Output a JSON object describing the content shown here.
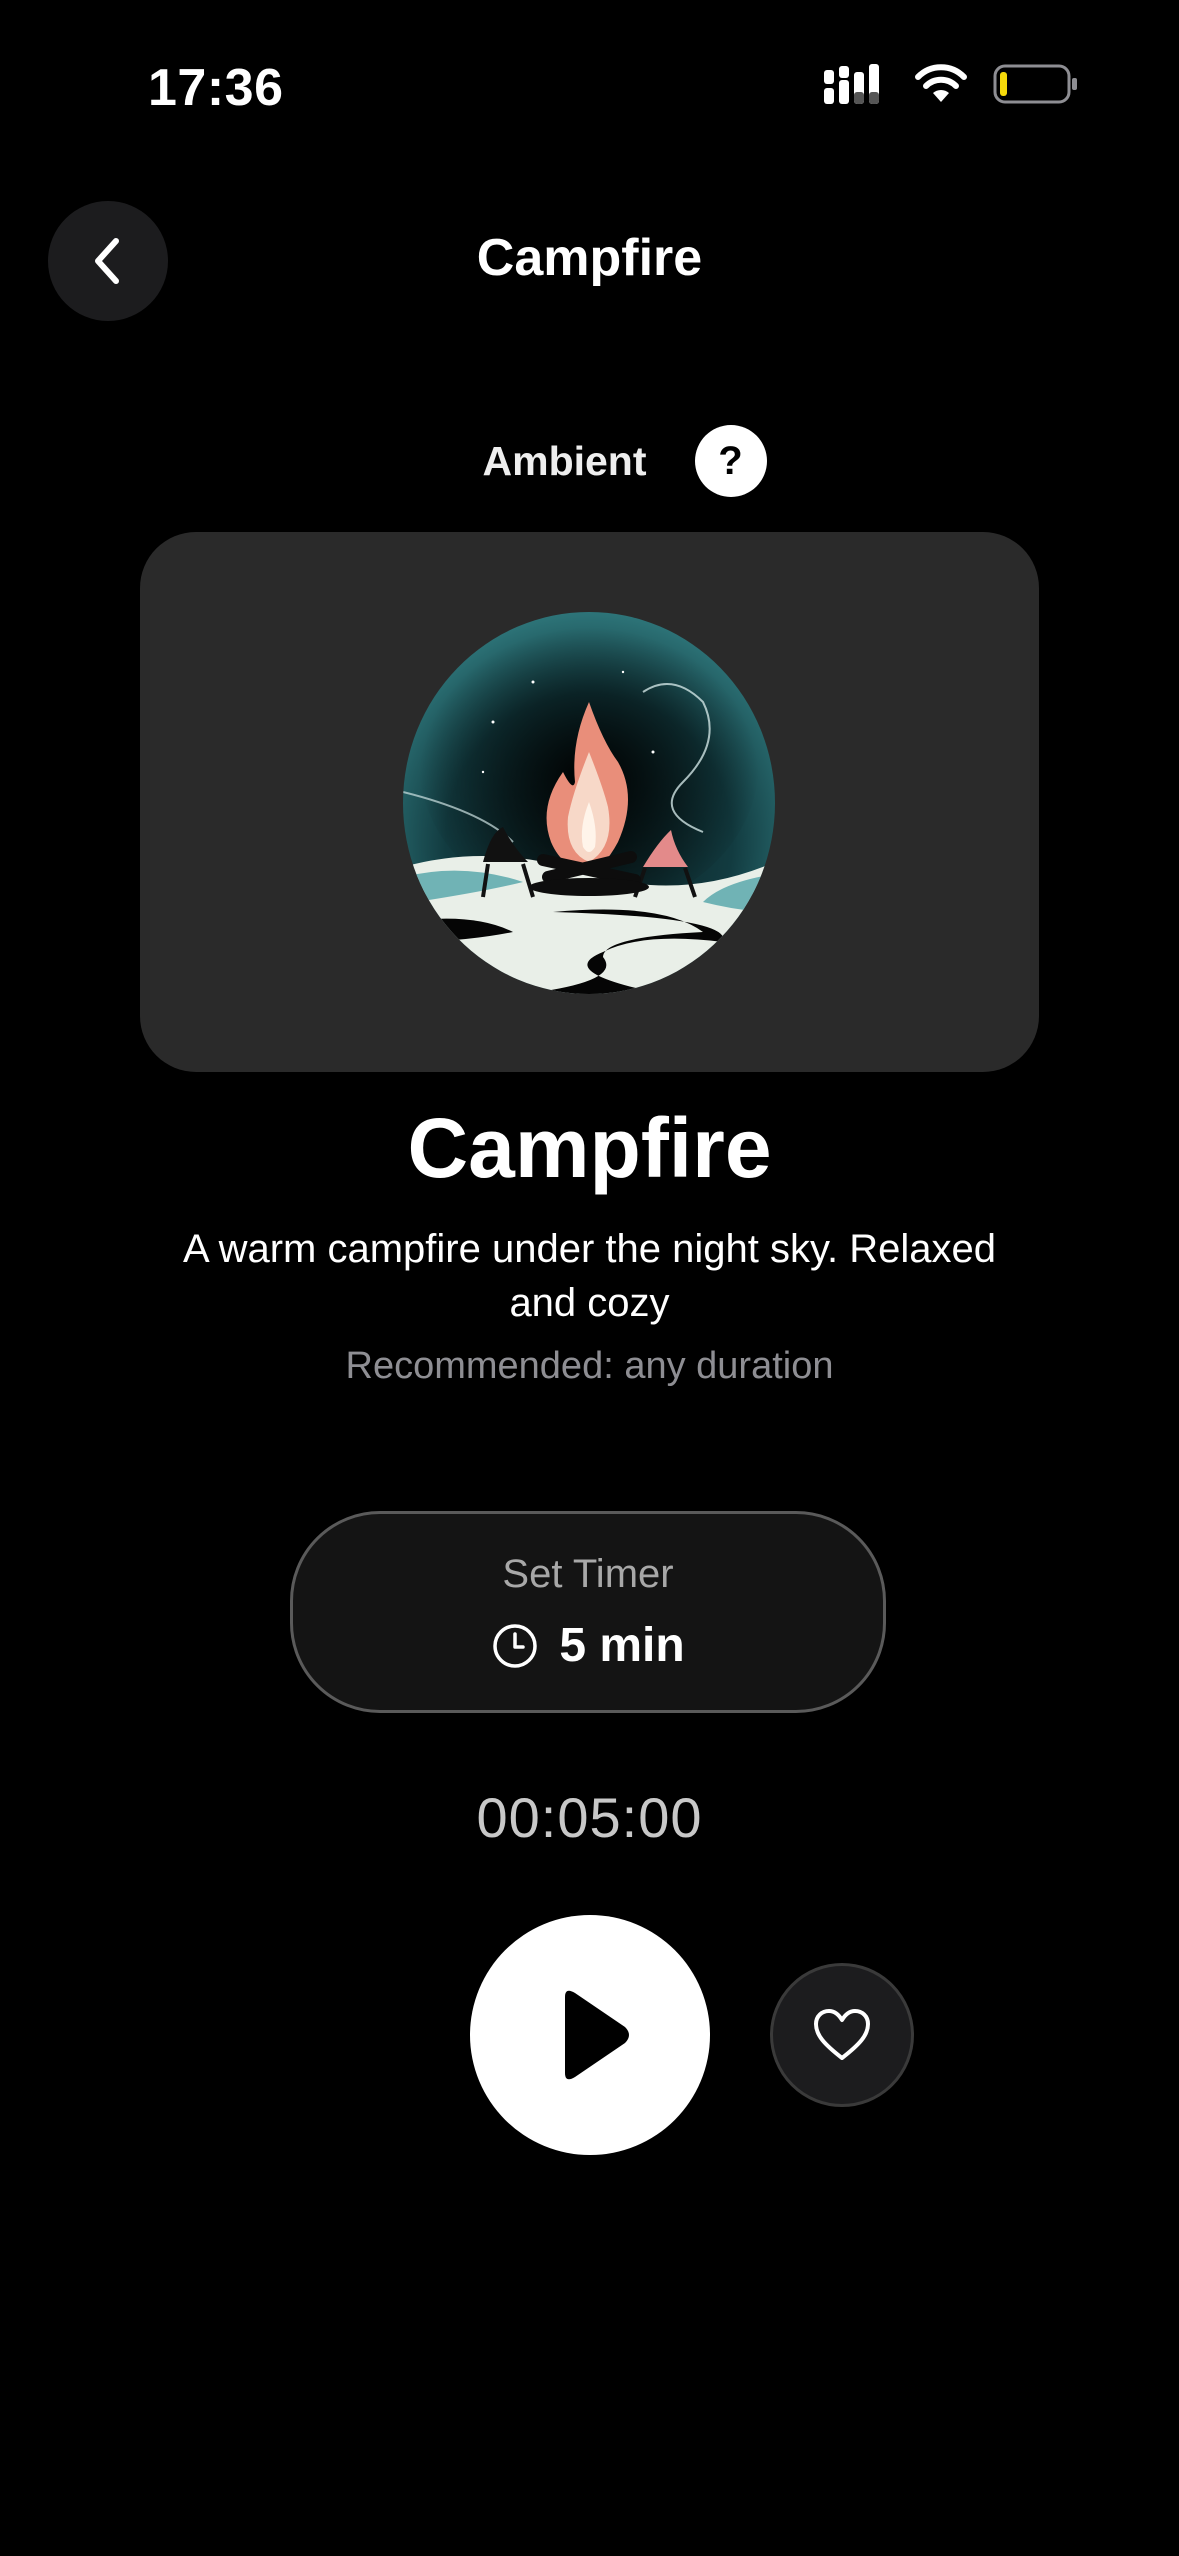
{
  "status_bar": {
    "time": "17:36",
    "icons": [
      "signal-icon",
      "wifi-icon",
      "battery-icon"
    ],
    "battery_color": "#f5d90a"
  },
  "header": {
    "back_icon": "chevron-left-icon",
    "title": "Campfire"
  },
  "category": {
    "label": "Ambient",
    "help_label": "?"
  },
  "sound": {
    "artwork_icon": "campfire-illustration",
    "title": "Campfire",
    "description": "A warm campfire under the night sky. Relaxed and cozy",
    "recommended": "Recommended: any duration"
  },
  "timer": {
    "label": "Set Timer",
    "icon": "clock-icon",
    "value": "5 min",
    "countdown": "00:05:00"
  },
  "controls": {
    "play_icon": "play-icon",
    "favorite_icon": "heart-icon"
  },
  "colors": {
    "background": "#000000",
    "card": "#2a2a2a",
    "muted_text": "#8e8e93",
    "accent": "#ffffff"
  }
}
